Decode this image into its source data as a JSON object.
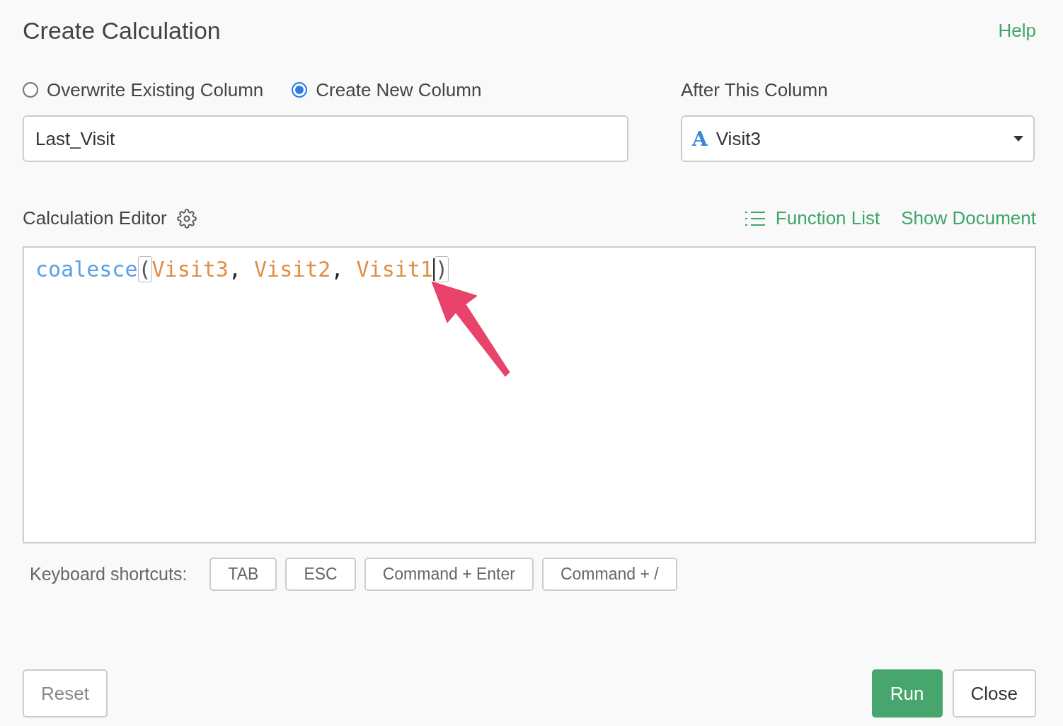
{
  "dialog": {
    "title": "Create Calculation",
    "help_link": "Help"
  },
  "mode_options": [
    {
      "label": "Overwrite Existing Column",
      "selected": false
    },
    {
      "label": "Create New Column",
      "selected": true
    }
  ],
  "new_column_name": {
    "value": "Last_Visit"
  },
  "after_column": {
    "label": "After This Column",
    "type_glyph": "A",
    "value": "Visit3"
  },
  "editor": {
    "title": "Calculation Editor",
    "function_list_link": "Function List",
    "show_document_link": "Show Document",
    "tokens": [
      {
        "kind": "function",
        "text": "coalesce"
      },
      {
        "kind": "paren",
        "text": "(",
        "highlighted": true
      },
      {
        "kind": "column",
        "text": "Visit3"
      },
      {
        "kind": "punct",
        "text": ", "
      },
      {
        "kind": "column",
        "text": "Visit2"
      },
      {
        "kind": "punct",
        "text": ", "
      },
      {
        "kind": "column",
        "text": "Visit1"
      },
      {
        "kind": "cursor"
      },
      {
        "kind": "paren",
        "text": ")",
        "highlighted": true
      }
    ]
  },
  "shortcuts": {
    "label": "Keyboard shortcuts:",
    "keys": [
      "TAB",
      "ESC",
      "Command + Enter",
      "Command + /"
    ]
  },
  "footer": {
    "reset_button": "Reset",
    "run_button": "Run",
    "close_button": "Close"
  }
}
